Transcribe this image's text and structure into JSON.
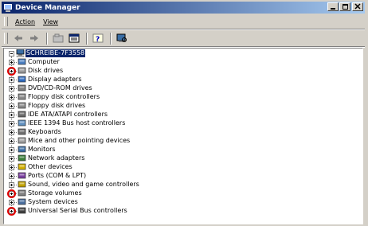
{
  "window": {
    "title": "Device Manager",
    "buttons": [
      "minimize-icon",
      "maximize-icon",
      "close-icon"
    ]
  },
  "menu": {
    "items": [
      {
        "label": "Action"
      },
      {
        "label": "View"
      }
    ]
  },
  "toolbar": {
    "buttons": [
      "back-arrow-icon",
      "forward-arrow-icon",
      "up-folder-icon",
      "properties-icon",
      "help-icon",
      "scan-hardware-icon"
    ]
  },
  "tree": {
    "root": "SCHREIBE-7F3558",
    "items": [
      {
        "label": "Computer",
        "icon": "computer-icon"
      },
      {
        "label": "Disk drives",
        "icon": "disk-drive-icon",
        "marked": true
      },
      {
        "label": "Display adapters",
        "icon": "display-adapter-icon"
      },
      {
        "label": "DVD/CD-ROM drives",
        "icon": "cdrom-icon"
      },
      {
        "label": "Floppy disk controllers",
        "icon": "floppy-controller-icon"
      },
      {
        "label": "Floppy disk drives",
        "icon": "floppy-drive-icon"
      },
      {
        "label": "IDE ATA/ATAPI controllers",
        "icon": "ide-controller-icon"
      },
      {
        "label": "IEEE 1394 Bus host controllers",
        "icon": "ieee1394-icon"
      },
      {
        "label": "Keyboards",
        "icon": "keyboard-icon"
      },
      {
        "label": "Mice and other pointing devices",
        "icon": "mouse-icon"
      },
      {
        "label": "Monitors",
        "icon": "monitor-icon"
      },
      {
        "label": "Network adapters",
        "icon": "network-adapter-icon"
      },
      {
        "label": "Other devices",
        "icon": "unknown-device-icon"
      },
      {
        "label": "Ports (COM & LPT)",
        "icon": "port-icon"
      },
      {
        "label": "Sound, video and game controllers",
        "icon": "sound-icon"
      },
      {
        "label": "Storage volumes",
        "icon": "storage-volume-icon",
        "marked": true
      },
      {
        "label": "System devices",
        "icon": "system-device-icon"
      },
      {
        "label": "Universal Serial Bus controllers",
        "icon": "usb-icon",
        "marked": true
      }
    ]
  },
  "colors": {
    "title_start": "#0a246a",
    "title_end": "#a6caf0",
    "selection": "#0a246a",
    "highlight_ring": "#e00000",
    "chrome": "#d4d0c8"
  }
}
